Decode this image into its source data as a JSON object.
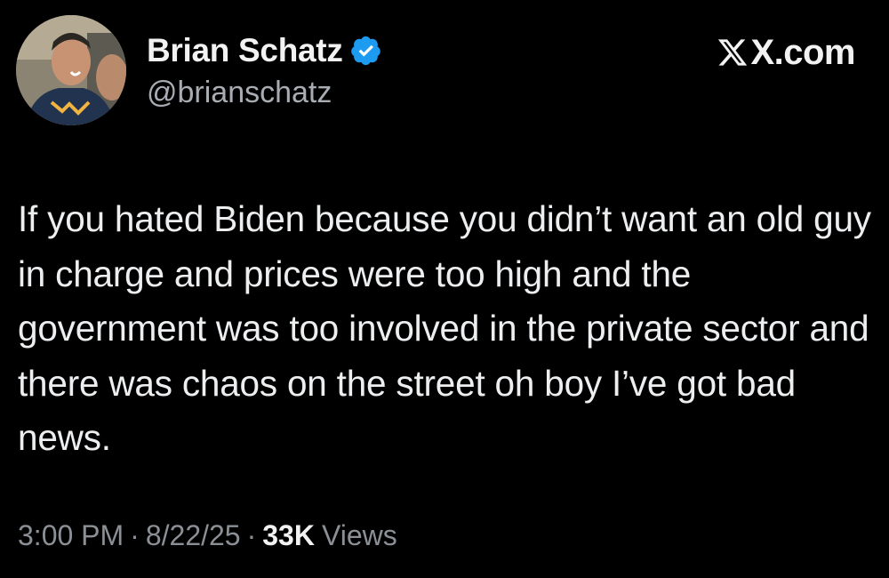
{
  "author": {
    "display_name": "Brian Schatz",
    "handle": "@brianschatz",
    "verified": true,
    "verified_badge_color": "#1d9bf0"
  },
  "site": {
    "logo_icon": "x-logo-icon",
    "label": "X.com"
  },
  "tweet": {
    "text": "If you hated Biden because you didn’t want an old guy in charge and prices were too high and the government was too involved in the private sector and there was chaos on the street oh boy I’ve got bad news."
  },
  "meta": {
    "time": "3:00 PM",
    "date": "8/22/25",
    "separator": "·",
    "views_count": "33K",
    "views_label": "Views"
  },
  "colors": {
    "background": "#000000",
    "text": "#e7e9ea",
    "muted": "#8b9096"
  }
}
